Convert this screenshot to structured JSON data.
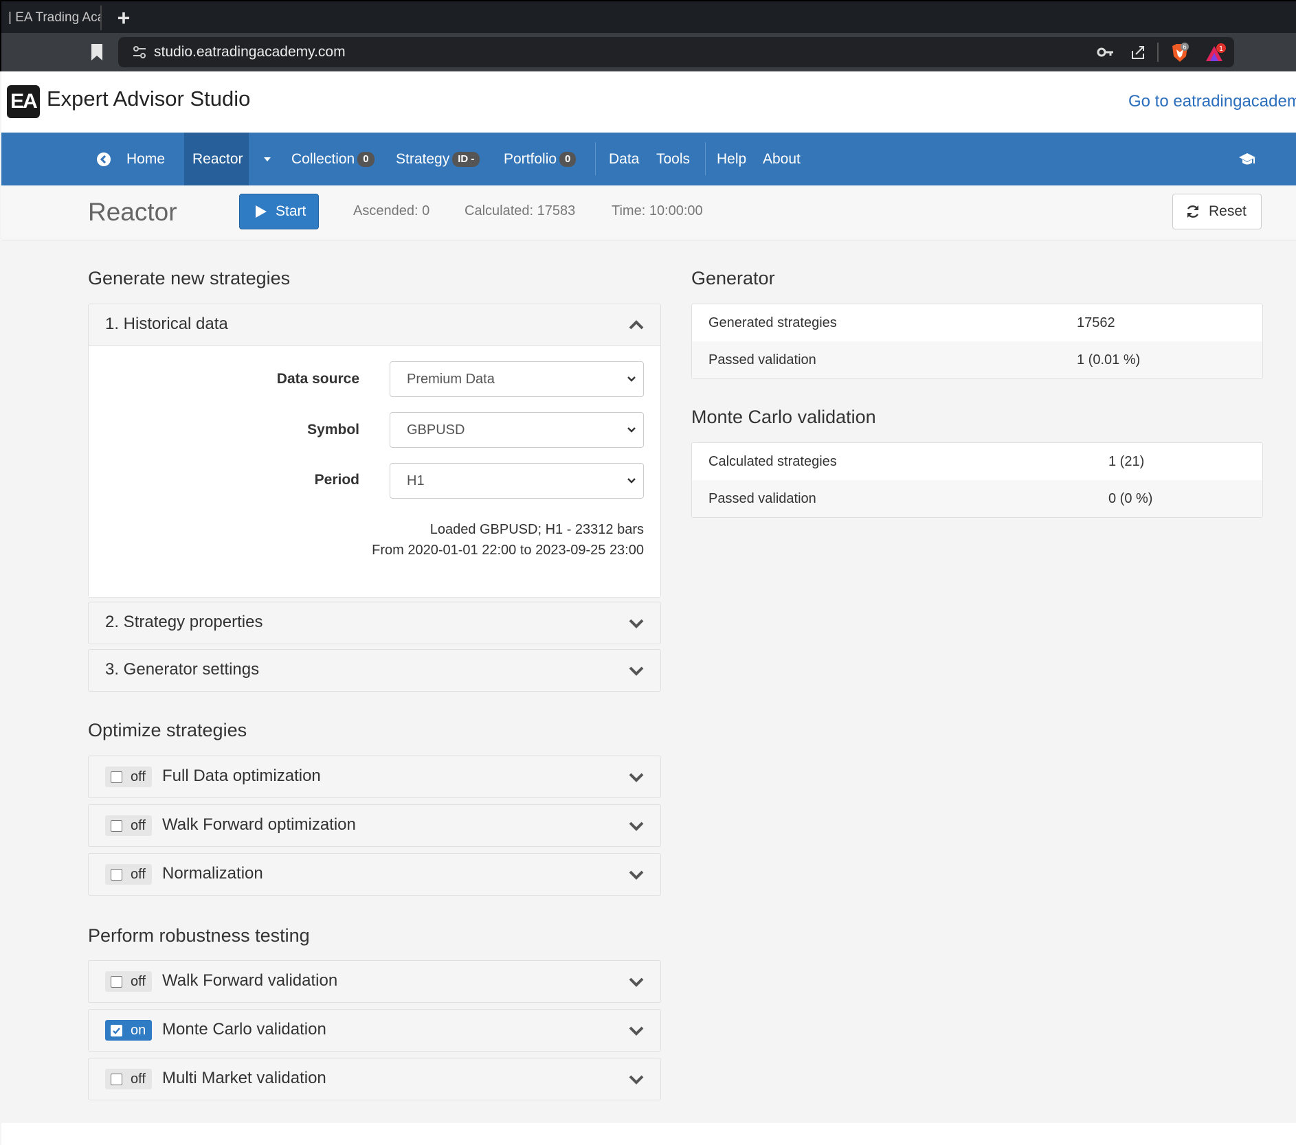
{
  "browser": {
    "tab_title": "| EA Trading Aca",
    "new_tab_label": "+",
    "url": "studio.eatradingacademy.com",
    "brave_shields_count": "6",
    "rewards_count": "1"
  },
  "brand": {
    "logo_text": "EA",
    "title": "Expert Advisor Studio",
    "go_link": "Go to eatradingacadem"
  },
  "nav": {
    "home": "Home",
    "reactor": "Reactor",
    "collection": "Collection",
    "collection_badge": "0",
    "strategy": "Strategy",
    "strategy_badge": "ID -",
    "portfolio": "Portfolio",
    "portfolio_badge": "0",
    "data": "Data",
    "tools": "Tools",
    "help": "Help",
    "about": "About"
  },
  "toolbar": {
    "title": "Reactor",
    "start_label": "Start",
    "ascended": "Ascended: 0",
    "calculated": "Calculated: 17583",
    "time": "Time: 10:00:00",
    "reset_label": "Reset"
  },
  "generate": {
    "section_title": "Generate new strategies",
    "historical_title": "1. Historical data",
    "data_source_label": "Data source",
    "data_source_value": "Premium Data",
    "symbol_label": "Symbol",
    "symbol_value": "GBPUSD",
    "period_label": "Period",
    "period_value": "H1",
    "loaded_line1": "Loaded GBPUSD; H1 - 23312 bars",
    "loaded_line2": "From 2020-01-01 22:00 to 2023-09-25 23:00",
    "strategy_props_title": "2. Strategy properties",
    "generator_settings_title": "3. Generator settings"
  },
  "optimize": {
    "section_title": "Optimize strategies",
    "items": [
      {
        "label": "Full Data optimization",
        "state": "off"
      },
      {
        "label": "Walk Forward optimization",
        "state": "off"
      },
      {
        "label": "Normalization",
        "state": "off"
      }
    ]
  },
  "robustness": {
    "section_title": "Perform robustness testing",
    "items": [
      {
        "label": "Walk Forward validation",
        "state": "off"
      },
      {
        "label": "Monte Carlo validation",
        "state": "on"
      },
      {
        "label": "Multi Market validation",
        "state": "off"
      }
    ]
  },
  "generator_stats": {
    "title": "Generator",
    "rows": [
      {
        "key": "Generated strategies",
        "value": "17562"
      },
      {
        "key": "Passed validation",
        "value": "1 (0.01 %)"
      }
    ]
  },
  "monte_carlo_stats": {
    "title": "Monte Carlo validation",
    "rows": [
      {
        "key": "Calculated strategies",
        "value": "1 (21)"
      },
      {
        "key": "Passed validation",
        "value": "0 (0 %)"
      }
    ]
  },
  "colors": {
    "navbar": "#3476b8",
    "navbar_active": "#265f99",
    "primary_button": "#2f7bc4",
    "link": "#2a6ebb"
  }
}
